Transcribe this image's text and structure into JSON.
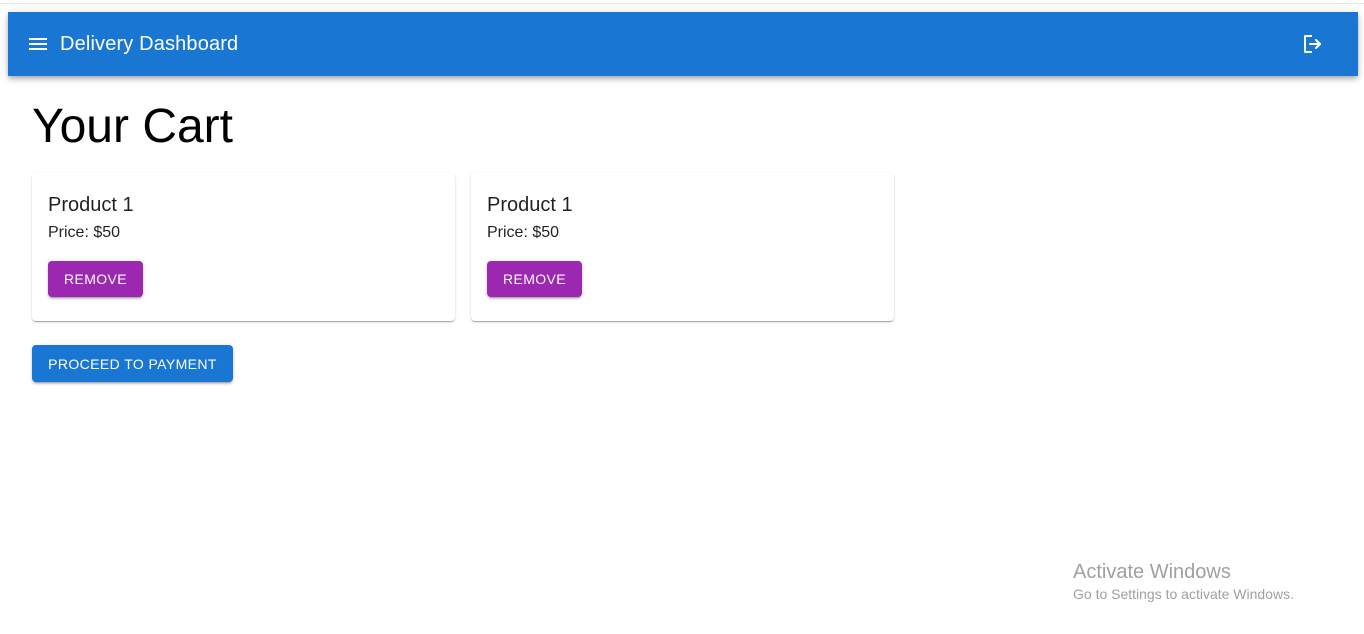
{
  "app": {
    "title": "Delivery Dashboard",
    "brand_color": "#1976d2",
    "menu_icon": "menu-icon",
    "logout_icon": "logout-icon"
  },
  "page": {
    "title": "Your Cart"
  },
  "cart": {
    "items": [
      {
        "name": "Product 1",
        "price": "Price: $50",
        "remove_label": "Remove"
      },
      {
        "name": "Product 1",
        "price": "Price: $50",
        "remove_label": "Remove"
      }
    ],
    "remove_color": "#9c27b0",
    "proceed_label": "Proceed to Payment"
  },
  "watermark": {
    "title": "Activate Windows",
    "subtitle": "Go to Settings to activate Windows."
  }
}
